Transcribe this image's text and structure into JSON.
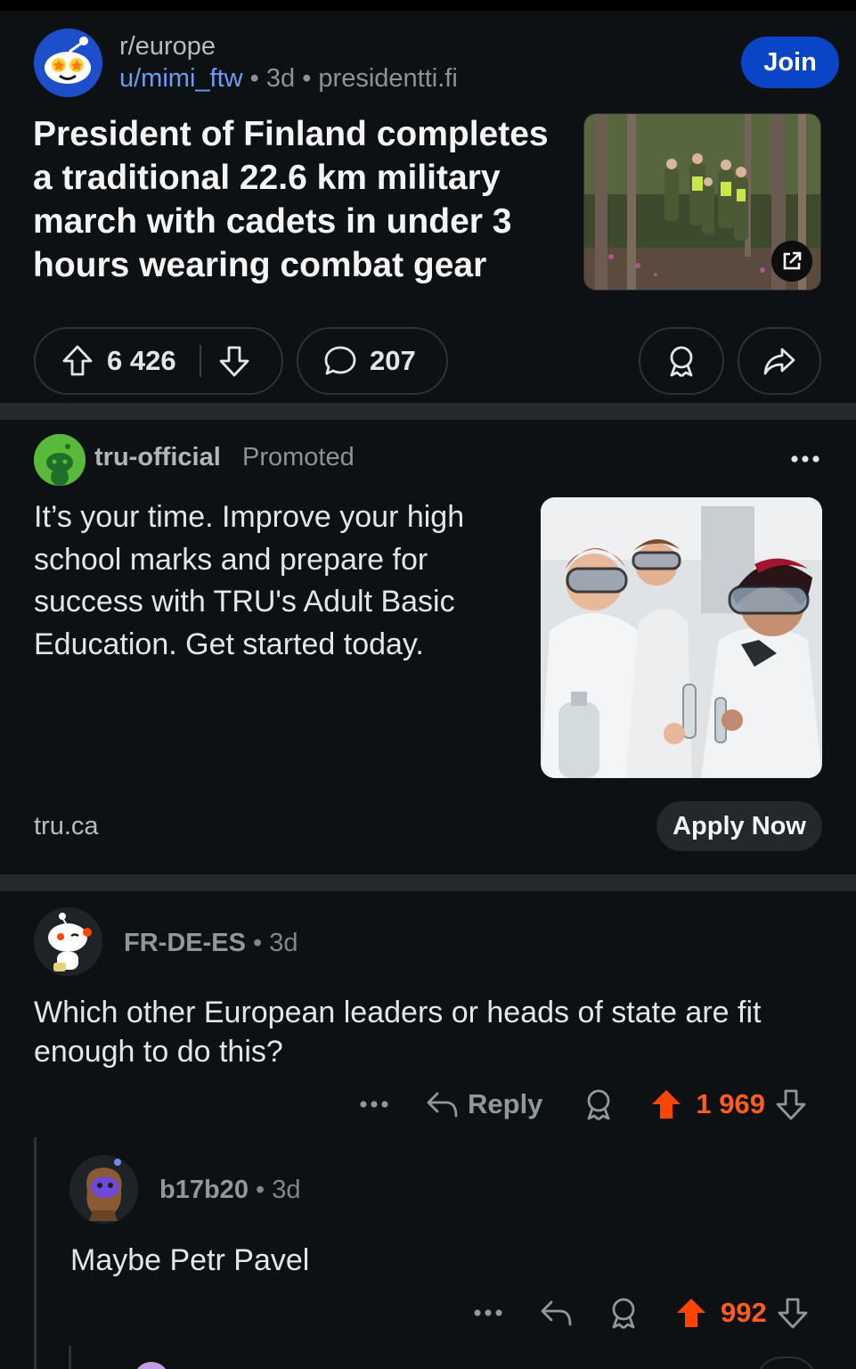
{
  "post": {
    "subreddit": "r/europe",
    "author": "u/mimi_ftw",
    "age": "3d",
    "domain": "presidentti.fi",
    "sep": "•",
    "join_label": "Join",
    "title": "President of Finland completes a traditional 22.6 km military march with cadets in under 3 hours wearing combat gear",
    "upvotes": "6 426",
    "comments": "207",
    "icons": [
      "reddit-snoo-icon",
      "external-link-icon",
      "upvote-icon",
      "downvote-icon",
      "comment-icon",
      "award-icon",
      "share-icon"
    ]
  },
  "ad": {
    "advertiser": "tru-official",
    "promoted_label": "Promoted",
    "text": "It’s your time. Improve your high school marks and prepare for success with TRU's Adult Basic Education. Get started today.",
    "domain": "tru.ca",
    "cta_label": "Apply Now"
  },
  "comments": [
    {
      "author": "FR-DE-ES",
      "age": "3d",
      "body": "Which other European leaders or heads of state are fit enough to do this?",
      "reply_label": "Reply",
      "score": "1 969"
    },
    {
      "author": "b17b20",
      "age": "3d",
      "body": "Maybe Petr Pavel",
      "score": "992"
    }
  ],
  "colors": {
    "background": "#0e1113",
    "join_button": "#0a45c8",
    "upvoted": "#ff4500",
    "link_blue": "#6d9df2"
  }
}
